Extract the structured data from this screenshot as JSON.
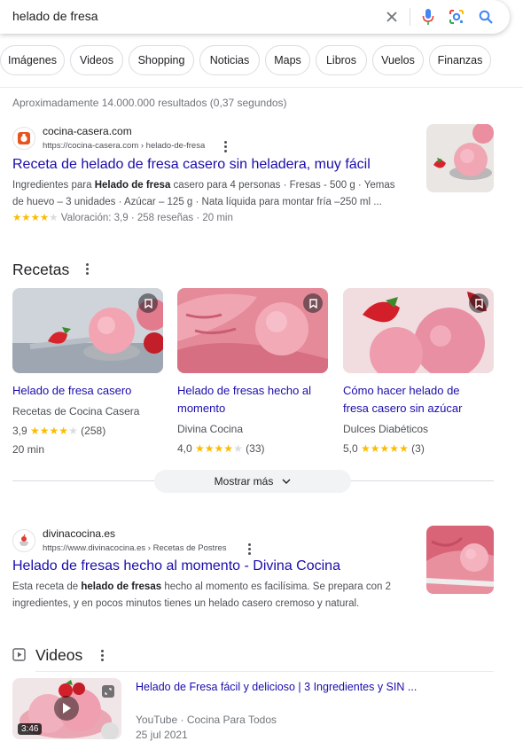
{
  "search": {
    "query": "helado de fresa"
  },
  "chips": [
    "Imágenes",
    "Videos",
    "Shopping",
    "Noticias",
    "Maps",
    "Libros",
    "Vuelos",
    "Finanzas"
  ],
  "stats": "Aproximadamente 14.000.000 resultados (0,37 segundos)",
  "result1": {
    "site": "cocina-casera.com",
    "url": "https://cocina-casera.com › helado-de-fresa",
    "title": "Receta de helado de fresa casero sin heladera, muy fácil",
    "snippet_line1_pre": "Ingredientes para ",
    "snippet_line1_bold": "Helado de fresa",
    "snippet_line1_post": " casero para 4 personas · Fresas - 500 g · Yemas",
    "snippet_line2": "de huevo – 3 unidades · Azúcar – 125 g · Nata líquida para montar fría –250 ml ...",
    "rating_text": "Valoración: 3,9 · 258 reseñas · 20 min",
    "rating_value": 3.9
  },
  "recipes": {
    "title": "Recetas",
    "cards": [
      {
        "title_line1": "Helado de fresa casero",
        "title_line2": "",
        "source": "Recetas de Cocina Casera",
        "rating": "3,9",
        "reviews": "(258)",
        "stars": 4,
        "time": "20 min"
      },
      {
        "title_line1": "Helado de fresas hecho al",
        "title_line2": "momento",
        "source": "Divina Cocina",
        "rating": "4,0",
        "reviews": "(33)",
        "stars": 4,
        "time": ""
      },
      {
        "title_line1": "Cómo hacer helado de",
        "title_line2": "fresa casero sin azúcar",
        "source": "Dulces Diabéticos",
        "rating": "5,0",
        "reviews": "(3)",
        "stars": 5,
        "time": ""
      }
    ],
    "more_label": "Mostrar más"
  },
  "result2": {
    "site": "divinacocina.es",
    "url": "https://www.divinacocina.es › Recetas de Postres",
    "title": "Helado de fresas hecho al momento - Divina Cocina",
    "snippet_line1_pre": "Esta receta de ",
    "snippet_line1_bold": "helado de fresas",
    "snippet_line1_post": " hecho al momento es facilísima. Se prepara con 2",
    "snippet_line2": "ingredientes, y en pocos minutos tienes un helado casero cremoso y natural."
  },
  "videos": {
    "title": "Videos",
    "items": [
      {
        "title": "Helado de Fresa fácil y delicioso | 3 Ingredientes y SIN ...",
        "platform": "YouTube · Cocina Para Todos",
        "date": "25 jul 2021",
        "duration": "3:46"
      }
    ]
  },
  "colors": {
    "link": "#1a0dab",
    "star": "#fbbc04",
    "google_blue": "#4285f4",
    "google_red": "#ea4335",
    "google_yellow": "#fbbc04",
    "google_green": "#34a853"
  }
}
